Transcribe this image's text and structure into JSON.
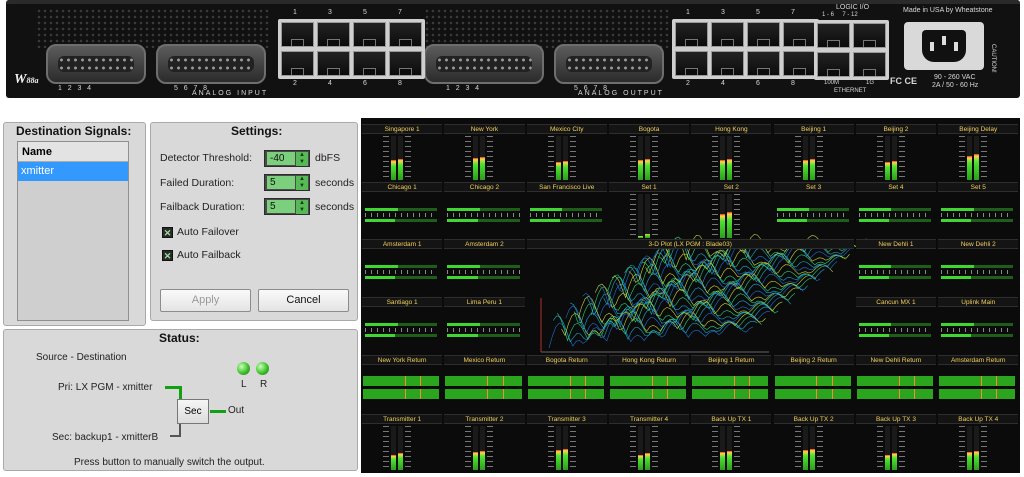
{
  "rack": {
    "top_numbers_a": [
      "1",
      "3",
      "5",
      "7"
    ],
    "bottom_numbers_a": [
      "2",
      "4",
      "6",
      "8"
    ],
    "top_numbers_b": [
      "1",
      "3",
      "5",
      "7"
    ],
    "bottom_numbers_b": [
      "2",
      "4",
      "6",
      "8"
    ],
    "dsub_numbers_in_1": "1   2   3   4",
    "dsub_numbers_in_2": "5   6   7   8",
    "dsub_numbers_out_1": "1   2   3   4",
    "dsub_numbers_out_2": "5   6   7   8",
    "analog_input": "ANALOG INPUT",
    "analog_output": "ANALOG OUTPUT",
    "logic_io": "LOGIC I/O",
    "logic_io_ranges": "1 - 6     7 - 12",
    "ethernet": "ETHERNET",
    "eth_100m": "100M",
    "eth_1g": "1G",
    "made_in": "Made in USA by Wheatstone",
    "power_rating": "90 - 260 VAC",
    "power_rating2": "2A / 50 - 60 Hz",
    "caution": "CAUTION!",
    "certs": "FC CE",
    "logo_text": "W",
    "logo_model": "88a"
  },
  "destination": {
    "title": "Destination Signals:",
    "column_header": "Name",
    "rows": [
      "xmitter"
    ]
  },
  "settings": {
    "title": "Settings:",
    "detector_threshold_label": "Detector Threshold:",
    "detector_threshold_value": "-40",
    "detector_threshold_unit": "dbFS",
    "failed_duration_label": "Failed Duration:",
    "failed_duration_value": "5",
    "failed_duration_unit": "seconds",
    "failback_duration_label": "Failback Duration:",
    "failback_duration_value": "5",
    "failback_duration_unit": "seconds",
    "auto_failover_label": "Auto Failover",
    "auto_failback_label": "Auto Failback",
    "apply_label": "Apply",
    "cancel_label": "Cancel"
  },
  "status": {
    "title": "Status:",
    "source_destination": "Source - Destination",
    "primary": "Pri: LX PGM - xmitter",
    "secondary": "Sec: backup1 - xmitterB",
    "sec_button": "Sec",
    "out_label": "Out",
    "led_left": "L",
    "led_right": "R",
    "footer": "Press button to manually switch the output."
  },
  "meters": {
    "row1": [
      {
        "name": "Singapore 1",
        "level": 0.45
      },
      {
        "name": "New York",
        "level": 0.5
      },
      {
        "name": "Mexico City",
        "level": 0.4
      },
      {
        "name": "Bogota",
        "level": 0.45
      },
      {
        "name": "Hong Kong",
        "level": 0.45
      },
      {
        "name": "Beijing 1",
        "level": 0.45
      },
      {
        "name": "Beijing 2",
        "level": 0.4
      },
      {
        "name": "Beijing Delay",
        "level": 0.55
      }
    ],
    "row2": [
      "Chicago 1",
      "Chicago 2",
      "San Francisco Live",
      "Set 1",
      "Set 2",
      "Set 3",
      "Set 4",
      "Set 5"
    ],
    "row3_left": [
      "Amsterdam 1",
      "Amsterdam 2"
    ],
    "row3_right": [
      "New Dehli 1",
      "New Dehli 2"
    ],
    "row4_left": [
      "Santiago 1",
      "Lima Peru 1"
    ],
    "row4_right": [
      "Cancun MX 1",
      "Uplink Main"
    ],
    "plot_title": "3-D Plot  (LX PGM : Blade03)",
    "row5": [
      "New York Return",
      "Mexico  Return",
      "Bogota  Return",
      "Hong Kong  Return",
      "Beijing 1  Return",
      "Beijing 2  Return",
      "New Dehli Return",
      "Amsterdam Return"
    ],
    "row6": [
      "Transmitter 1",
      "Transmitter 2",
      "Transmitter 3",
      "Transmitter 4",
      "Back Up TX 1",
      "Back Up TX 2",
      "Back Up TX 3",
      "Back Up TX 4"
    ]
  }
}
